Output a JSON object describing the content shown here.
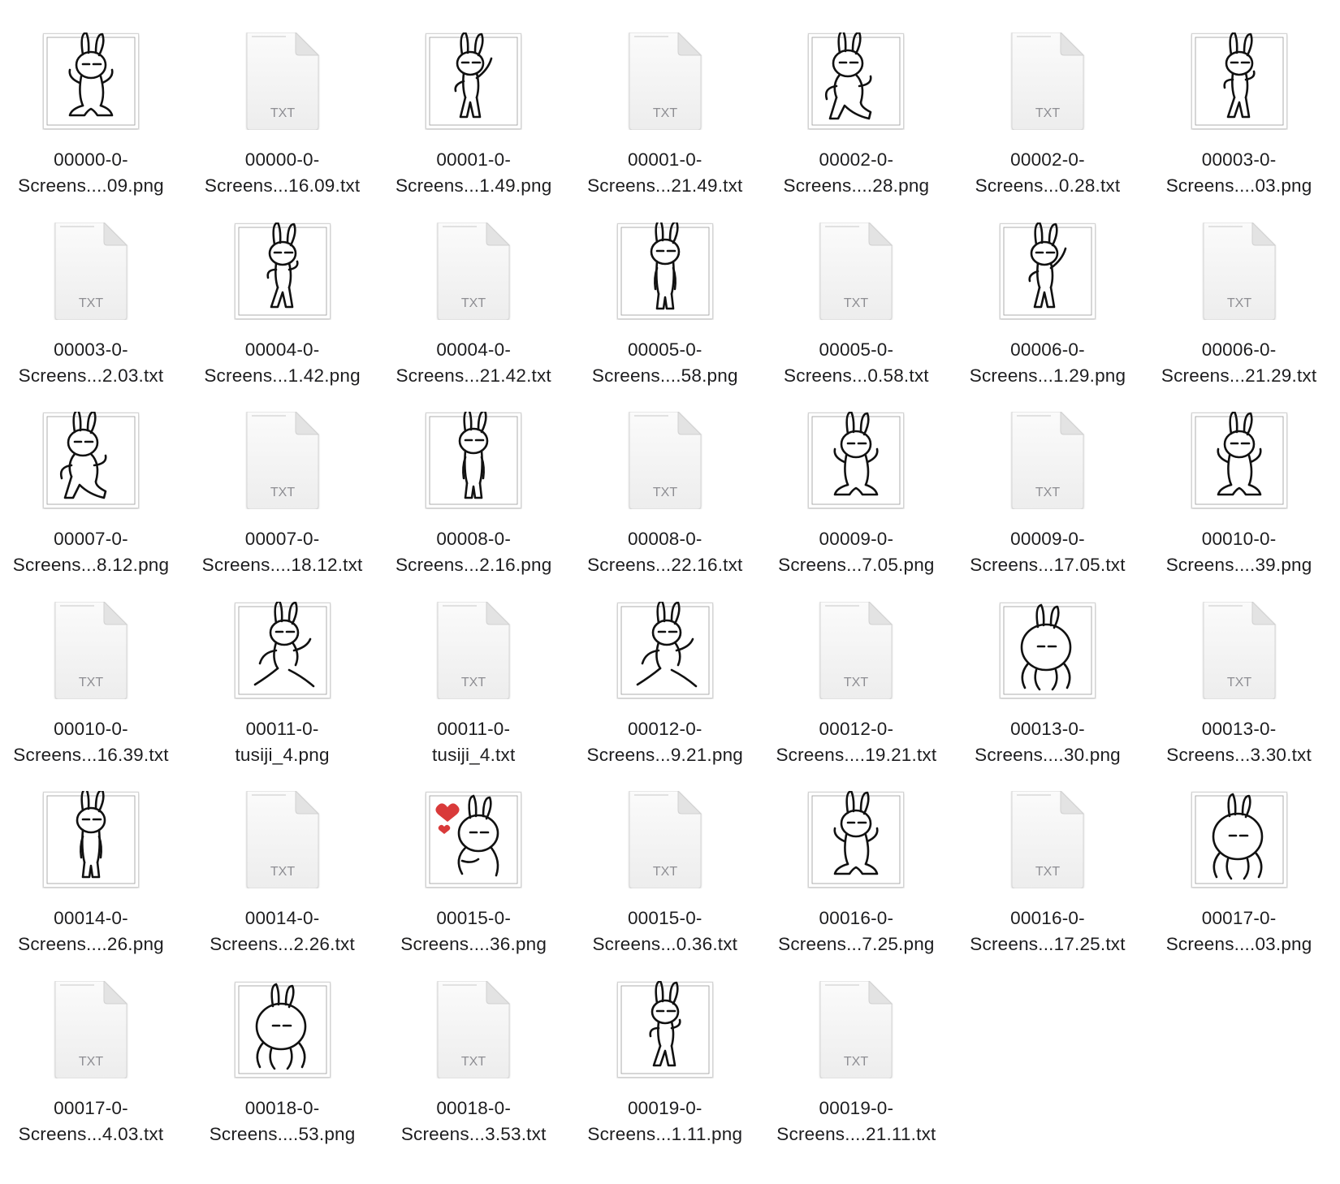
{
  "view": "Finder icon view",
  "colors": {
    "text": "#1d1d1f",
    "txt_badge": "#8e8e93",
    "heart": "#d93a3a"
  },
  "items": [
    {
      "line1": "00000-0-",
      "line2": "Screens....09.png",
      "kind": "png",
      "pose": "squat",
      "icon": "image-thumbnail-icon"
    },
    {
      "line1": "00000-0-",
      "line2": "Screens...16.09.txt",
      "kind": "txt",
      "badge": "TXT",
      "icon": "text-document-icon"
    },
    {
      "line1": "00001-0-",
      "line2": "Screens...1.49.png",
      "kind": "png",
      "pose": "wave",
      "icon": "image-thumbnail-icon"
    },
    {
      "line1": "00001-0-",
      "line2": "Screens...21.49.txt",
      "kind": "txt",
      "badge": "TXT",
      "icon": "text-document-icon"
    },
    {
      "line1": "00002-0-",
      "line2": "Screens....28.png",
      "kind": "png",
      "pose": "lean",
      "icon": "image-thumbnail-icon"
    },
    {
      "line1": "00002-0-",
      "line2": "Screens...0.28.txt",
      "kind": "txt",
      "badge": "TXT",
      "icon": "text-document-icon"
    },
    {
      "line1": "00003-0-",
      "line2": "Screens....03.png",
      "kind": "png",
      "pose": "dance",
      "icon": "image-thumbnail-icon"
    },
    {
      "line1": "00003-0-",
      "line2": "Screens...2.03.txt",
      "kind": "txt",
      "badge": "TXT",
      "icon": "text-document-icon"
    },
    {
      "line1": "00004-0-",
      "line2": "Screens...1.42.png",
      "kind": "png",
      "pose": "dance",
      "icon": "image-thumbnail-icon"
    },
    {
      "line1": "00004-0-",
      "line2": "Screens...21.42.txt",
      "kind": "txt",
      "badge": "TXT",
      "icon": "text-document-icon"
    },
    {
      "line1": "00005-0-",
      "line2": "Screens....58.png",
      "kind": "png",
      "pose": "stand",
      "icon": "image-thumbnail-icon"
    },
    {
      "line1": "00005-0-",
      "line2": "Screens...0.58.txt",
      "kind": "txt",
      "badge": "TXT",
      "icon": "text-document-icon"
    },
    {
      "line1": "00006-0-",
      "line2": "Screens...1.29.png",
      "kind": "png",
      "pose": "wave",
      "icon": "image-thumbnail-icon"
    },
    {
      "line1": "00006-0-",
      "line2": "Screens...21.29.txt",
      "kind": "txt",
      "badge": "TXT",
      "icon": "text-document-icon"
    },
    {
      "line1": "00007-0-",
      "line2": "Screens...8.12.png",
      "kind": "png",
      "pose": "lean",
      "icon": "image-thumbnail-icon"
    },
    {
      "line1": "00007-0-",
      "line2": "Screens....18.12.txt",
      "kind": "txt",
      "badge": "TXT",
      "icon": "text-document-icon"
    },
    {
      "line1": "00008-0-",
      "line2": "Screens...2.16.png",
      "kind": "png",
      "pose": "stand",
      "icon": "image-thumbnail-icon"
    },
    {
      "line1": "00008-0-",
      "line2": "Screens...22.16.txt",
      "kind": "txt",
      "badge": "TXT",
      "icon": "text-document-icon"
    },
    {
      "line1": "00009-0-",
      "line2": "Screens...7.05.png",
      "kind": "png",
      "pose": "squat",
      "icon": "image-thumbnail-icon"
    },
    {
      "line1": "00009-0-",
      "line2": "Screens...17.05.txt",
      "kind": "txt",
      "badge": "TXT",
      "icon": "text-document-icon"
    },
    {
      "line1": "00010-0-",
      "line2": "Screens....39.png",
      "kind": "png",
      "pose": "squat",
      "icon": "image-thumbnail-icon"
    },
    {
      "line1": "00010-0-",
      "line2": "Screens...16.39.txt",
      "kind": "txt",
      "badge": "TXT",
      "icon": "text-document-icon"
    },
    {
      "line1": "00011-0-",
      "line2": "tusiji_4.png",
      "kind": "png",
      "pose": "run",
      "icon": "image-thumbnail-icon"
    },
    {
      "line1": "00011-0-",
      "line2": "tusiji_4.txt",
      "kind": "txt",
      "badge": "TXT",
      "icon": "text-document-icon"
    },
    {
      "line1": "00012-0-",
      "line2": "Screens...9.21.png",
      "kind": "png",
      "pose": "run",
      "icon": "image-thumbnail-icon"
    },
    {
      "line1": "00012-0-",
      "line2": "Screens....19.21.txt",
      "kind": "txt",
      "badge": "TXT",
      "icon": "text-document-icon"
    },
    {
      "line1": "00013-0-",
      "line2": "Screens....30.png",
      "kind": "png",
      "pose": "closeup",
      "icon": "image-thumbnail-icon"
    },
    {
      "line1": "00013-0-",
      "line2": "Screens...3.30.txt",
      "kind": "txt",
      "badge": "TXT",
      "icon": "text-document-icon"
    },
    {
      "line1": "00014-0-",
      "line2": "Screens....26.png",
      "kind": "png",
      "pose": "stand",
      "icon": "image-thumbnail-icon"
    },
    {
      "line1": "00014-0-",
      "line2": "Screens...2.26.txt",
      "kind": "txt",
      "badge": "TXT",
      "icon": "text-document-icon"
    },
    {
      "line1": "00015-0-",
      "line2": "Screens....36.png",
      "kind": "png",
      "pose": "heart",
      "icon": "image-thumbnail-icon"
    },
    {
      "line1": "00015-0-",
      "line2": "Screens...0.36.txt",
      "kind": "txt",
      "badge": "TXT",
      "icon": "text-document-icon"
    },
    {
      "line1": "00016-0-",
      "line2": "Screens...7.25.png",
      "kind": "png",
      "pose": "squat",
      "icon": "image-thumbnail-icon"
    },
    {
      "line1": "00016-0-",
      "line2": "Screens...17.25.txt",
      "kind": "txt",
      "badge": "TXT",
      "icon": "text-document-icon"
    },
    {
      "line1": "00017-0-",
      "line2": "Screens....03.png",
      "kind": "png",
      "pose": "closeup",
      "icon": "image-thumbnail-icon"
    },
    {
      "line1": "00017-0-",
      "line2": "Screens...4.03.txt",
      "kind": "txt",
      "badge": "TXT",
      "icon": "text-document-icon"
    },
    {
      "line1": "00018-0-",
      "line2": "Screens....53.png",
      "kind": "png",
      "pose": "closeup",
      "icon": "image-thumbnail-icon"
    },
    {
      "line1": "00018-0-",
      "line2": "Screens...3.53.txt",
      "kind": "txt",
      "badge": "TXT",
      "icon": "text-document-icon"
    },
    {
      "line1": "00019-0-",
      "line2": "Screens...1.11.png",
      "kind": "png",
      "pose": "dance",
      "icon": "image-thumbnail-icon"
    },
    {
      "line1": "00019-0-",
      "line2": "Screens....21.11.txt",
      "kind": "txt",
      "badge": "TXT",
      "icon": "text-document-icon"
    }
  ]
}
